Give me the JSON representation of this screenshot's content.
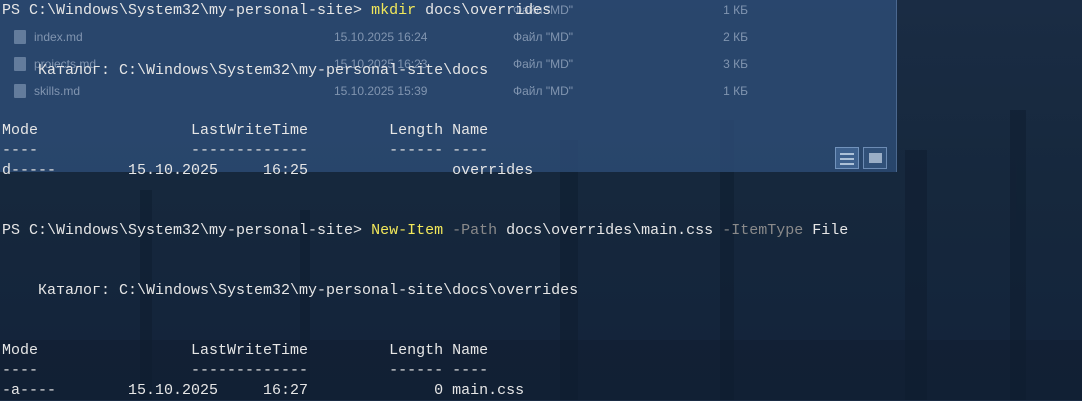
{
  "explorer": {
    "files": [
      {
        "name": "",
        "date": "",
        "type": "Файл \"MD\"",
        "size": "1 КБ"
      },
      {
        "name": "index.md",
        "date": "15.10.2025 16:24",
        "type": "Файл \"MD\"",
        "size": "2 КБ"
      },
      {
        "name": "projects.md",
        "date": "15.10.2025 16:23",
        "type": "Файл \"MD\"",
        "size": "3 КБ"
      },
      {
        "name": "skills.md",
        "date": "15.10.2025 15:39",
        "type": "Файл \"MD\"",
        "size": "1 КБ"
      }
    ]
  },
  "terminal": {
    "prompt": "PS C:\\Windows\\System32\\my-personal-site>",
    "cmd1": {
      "name": "mkdir",
      "arg": "docs\\overrides",
      "catalog": "    Каталог: C:\\Windows\\System32\\my-personal-site\\docs",
      "header": "Mode                 LastWriteTime         Length Name",
      "dashes": "----                 -------------         ------ ----",
      "row": "d-----        15.10.2025     16:25                overrides"
    },
    "cmd2": {
      "name": "New-Item",
      "p1": "-Path",
      "v1": "docs\\overrides\\main.css",
      "p2": "-ItemType",
      "v2": "File",
      "catalog": "    Каталог: C:\\Windows\\System32\\my-personal-site\\docs\\overrides",
      "header": "Mode                 LastWriteTime         Length Name",
      "dashes": "----                 -------------         ------ ----",
      "row": "-a----        15.10.2025     16:27              0 main.css"
    }
  }
}
